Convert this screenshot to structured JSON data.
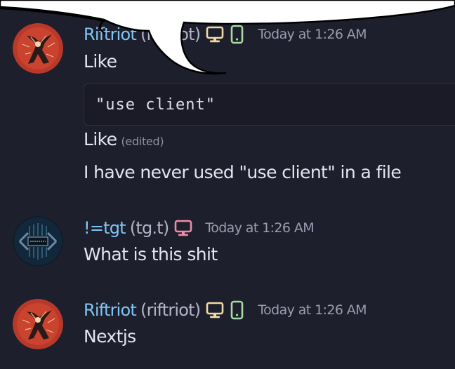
{
  "messages": [
    {
      "username": "Riftriot",
      "handle": "(riftriot)",
      "username_color": "#7ec6f5",
      "timestamp": "Today at 1:26 AM",
      "platform_icons": [
        "desktop-icon",
        "mobile-icon"
      ],
      "avatar": "riftriot-avatar",
      "lines": [
        {
          "type": "text",
          "text": "Like"
        },
        {
          "type": "code",
          "text": "\"use client\""
        },
        {
          "type": "text",
          "text": "Like",
          "edited": "(edited)"
        },
        {
          "type": "text",
          "text": "I have never used \"use client\" in a file"
        }
      ]
    },
    {
      "username": "!=tgt",
      "handle": "(tg.t)",
      "username_color": "#7ec6f5",
      "timestamp": "Today at 1:26 AM",
      "platform_icons": [
        "desktop-icon"
      ],
      "avatar": "tgt-avatar",
      "lines": [
        {
          "type": "text",
          "text": "What is this shit"
        }
      ]
    },
    {
      "username": "Riftriot",
      "handle": "(riftriot)",
      "username_color": "#7ec6f5",
      "timestamp": "Today at 1:26 AM",
      "platform_icons": [
        "desktop-icon",
        "mobile-icon"
      ],
      "avatar": "riftriot-avatar",
      "lines": [
        {
          "type": "text",
          "text": "Nextjs"
        }
      ]
    }
  ],
  "colors": {
    "background": "#1e1f2c",
    "username": "#7ec6f5",
    "handle": "#b3b5c7",
    "timestamp": "#9b9db0",
    "desktop_icon_riftriot": "#f0d9a6",
    "mobile_icon": "#a8dba0",
    "desktop_icon_tgt": "#f08aa8",
    "avatar_riftriot_bg": "#b8382a"
  }
}
